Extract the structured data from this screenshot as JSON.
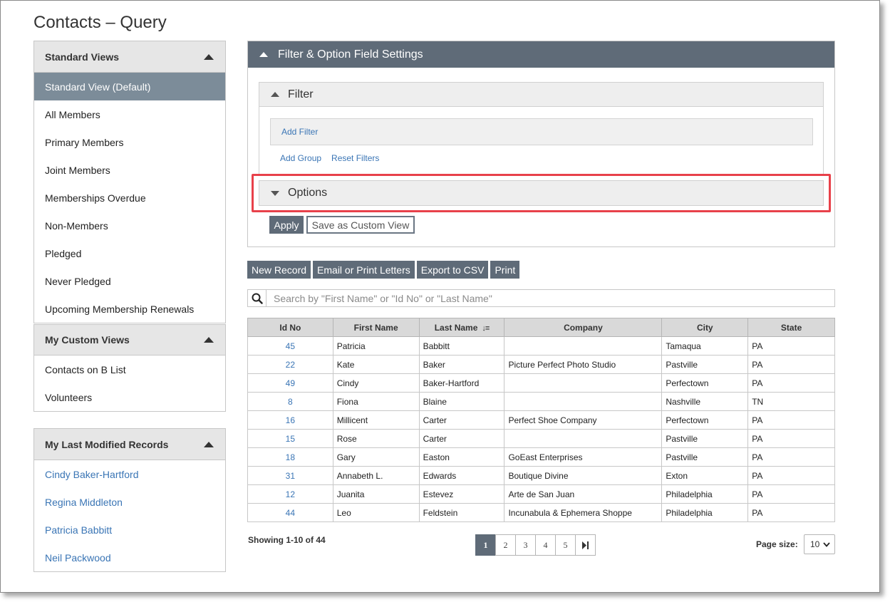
{
  "page": {
    "title": "Contacts – Query"
  },
  "standard_views": {
    "title": "Standard Views",
    "items": [
      "Standard View (Default)",
      "All Members",
      "Primary Members",
      "Joint Members",
      "Memberships Overdue",
      "Non-Members",
      "Pledged",
      "Never Pledged",
      "Upcoming Membership Renewals"
    ],
    "active_index": 0
  },
  "custom_views": {
    "title": "My Custom Views",
    "items": [
      "Contacts on B List",
      "Volunteers"
    ]
  },
  "last_modified": {
    "title": "My Last Modified Records",
    "items": [
      "Cindy Baker-Hartford",
      "Regina Middleton",
      "Patricia Babbitt",
      "Neil Packwood"
    ]
  },
  "settings": {
    "title": "Filter & Option Field Settings",
    "filter": {
      "title": "Filter",
      "add_filter": "Add Filter",
      "add_group": "Add Group",
      "reset_filters": "Reset Filters"
    },
    "options": {
      "title": "Options"
    },
    "apply": "Apply",
    "save_custom": "Save as Custom View"
  },
  "toolbar": {
    "new_record": "New Record",
    "email_print": "Email or Print Letters",
    "export_csv": "Export to CSV",
    "print": "Print"
  },
  "search": {
    "placeholder": "Search by \"First Name\" or \"Id No\" or \"Last Name\"",
    "value": ""
  },
  "table": {
    "columns": [
      "Id No",
      "First Name",
      "Last Name",
      "Company",
      "City",
      "State"
    ],
    "sorted_column": "Last Name",
    "rows": [
      [
        "45",
        "Patricia",
        "Babbitt",
        "",
        "Tamaqua",
        "PA"
      ],
      [
        "22",
        "Kate",
        "Baker",
        "Picture Perfect Photo Studio",
        "Pastville",
        "PA"
      ],
      [
        "49",
        "Cindy",
        "Baker-Hartford",
        "",
        "Perfectown",
        "PA"
      ],
      [
        "8",
        "Fiona",
        "Blaine",
        "",
        "Nashville",
        "TN"
      ],
      [
        "16",
        "Millicent",
        "Carter",
        "Perfect Shoe Company",
        "Perfectown",
        "PA"
      ],
      [
        "15",
        "Rose",
        "Carter",
        "",
        "Pastville",
        "PA"
      ],
      [
        "18",
        "Gary",
        "Easton",
        "GoEast Enterprises",
        "Pastville",
        "PA"
      ],
      [
        "31",
        "Annabeth L.",
        "Edwards",
        "Boutique Divine",
        "Exton",
        "PA"
      ],
      [
        "12",
        "Juanita",
        "Estevez",
        "Arte de San Juan",
        "Philadelphia",
        "PA"
      ],
      [
        "44",
        "Leo",
        "Feldstein",
        "Incunabula & Ephemera Shoppe",
        "Philadelphia",
        "PA"
      ]
    ]
  },
  "footer": {
    "showing": "Showing 1-10 of 44",
    "pages": [
      "1",
      "2",
      "3",
      "4",
      "5"
    ],
    "current_page": "1",
    "page_size_label": "Page size:",
    "page_size": "10"
  },
  "colors": {
    "header_dark": "#5f6b78",
    "active_nav": "#7c8c99",
    "link": "#3a75b5",
    "highlight": "#e8414a"
  }
}
